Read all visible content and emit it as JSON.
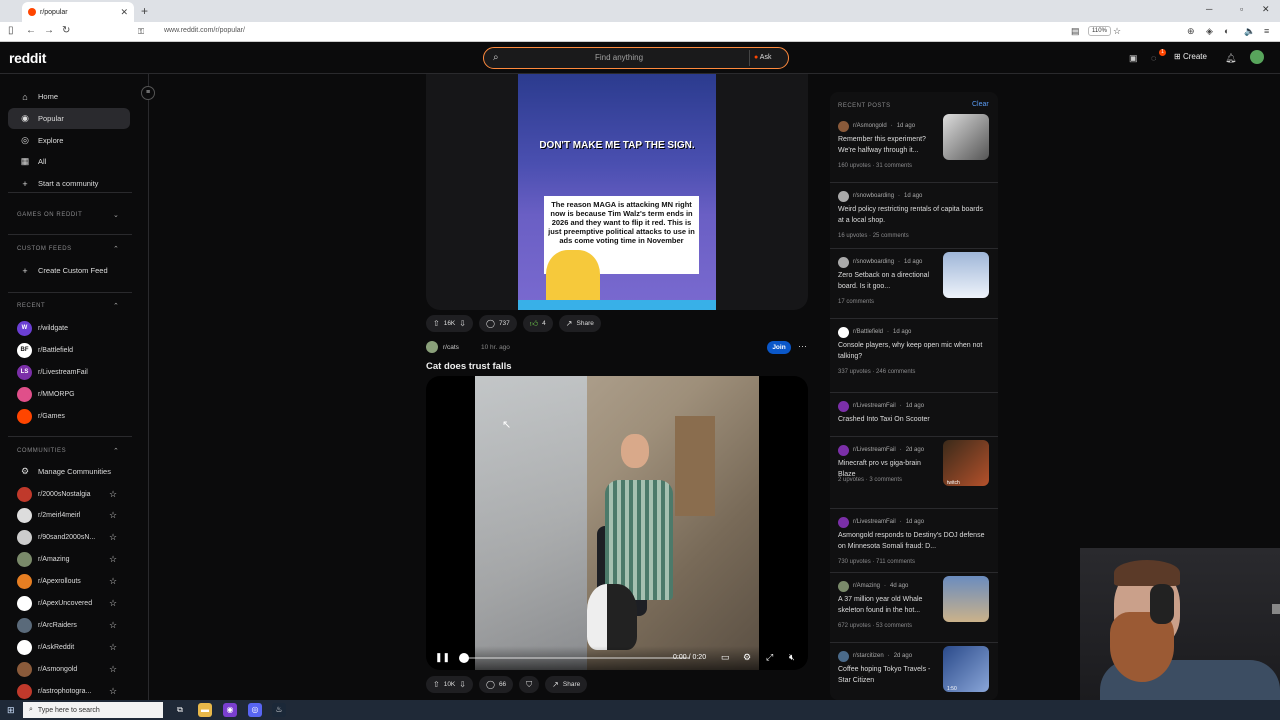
{
  "browser": {
    "tab_title": "r/popular",
    "url": "www.reddit.com/r/popular/",
    "zoom": "110%"
  },
  "header": {
    "logo": "reddit",
    "search_placeholder": "Find anything",
    "ask_label": "Ask",
    "create_label": "Create",
    "chat_badge": "1"
  },
  "sidebar": {
    "nav": [
      {
        "label": "Home",
        "icon": "home-icon"
      },
      {
        "label": "Popular",
        "icon": "popular-icon"
      },
      {
        "label": "Explore",
        "icon": "explore-icon"
      },
      {
        "label": "All",
        "icon": "all-icon"
      },
      {
        "label": "Start a community",
        "icon": "plus-icon"
      }
    ],
    "games_header": "GAMES ON REDDIT",
    "custom_feeds_header": "CUSTOM FEEDS",
    "create_custom_feed": "Create Custom Feed",
    "recent_header": "RECENT",
    "recent": [
      {
        "name": "r/wildgate",
        "color": "#6b3fd4",
        "abbr": "W"
      },
      {
        "name": "r/Battlefield",
        "color": "#ffffff",
        "abbr": "BF"
      },
      {
        "name": "r/LivestreamFail",
        "color": "#7b2fa8",
        "abbr": "LS"
      },
      {
        "name": "r/MMORPG",
        "color": "#e04f8a",
        "abbr": ""
      },
      {
        "name": "r/Games",
        "color": "#ff4500",
        "abbr": ""
      }
    ],
    "communities_header": "COMMUNITIES",
    "manage_communities": "Manage Communities",
    "communities": [
      {
        "name": "r/2000sNostalgia",
        "color": "#c0392b"
      },
      {
        "name": "r/2meirl4meirl",
        "color": "#dddddd"
      },
      {
        "name": "r/90sand2000sN...",
        "color": "#cccccc"
      },
      {
        "name": "r/Amazing",
        "color": "#7a8a6a"
      },
      {
        "name": "r/Apexrollouts",
        "color": "#e67e22"
      },
      {
        "name": "r/ApexUncovered",
        "color": "#ffffff"
      },
      {
        "name": "r/ArcRaiders",
        "color": "#5a6a7a"
      },
      {
        "name": "r/AskReddit",
        "color": "#ffffff"
      },
      {
        "name": "r/Asmongold",
        "color": "#8a5a3a"
      },
      {
        "name": "r/astrophotogra...",
        "color": "#c0392b"
      }
    ]
  },
  "post1": {
    "meme_caption": "DON'T MAKE ME TAP THE SIGN.",
    "sign_text": "The reason MAGA is attacking MN right now is because Tim Walz's term ends in 2026 and they want to flip it red. This is just preemptive political attacks to use in ads come voting time in November",
    "upvotes": "16K",
    "comments": "737",
    "awards": "4",
    "share": "Share"
  },
  "post2": {
    "subreddit": "r/cats",
    "time": "10 hr. ago",
    "join": "Join",
    "title": "Cat does trust falls",
    "video_time": "0:00 / 0:20",
    "upvotes": "10K",
    "comments": "66",
    "share": "Share"
  },
  "recent_posts": {
    "header": "RECENT POSTS",
    "clear": "Clear",
    "items": [
      {
        "sub": "r/Asmongold",
        "time": "1d ago",
        "title": "Remember this experiment? We're halfway through it...",
        "upvotes": "160 upvotes",
        "comments": "31 comments",
        "thumb": true,
        "color": "#8a5a3a"
      },
      {
        "sub": "r/snowboarding",
        "time": "1d ago",
        "title": "Weird policy restricting rentals of capita boards at a local shop.",
        "upvotes": "16 upvotes",
        "comments": "25 comments",
        "thumb": false,
        "color": "#aaaaaa"
      },
      {
        "sub": "r/snowboarding",
        "time": "1d ago",
        "title": "Zero Setback on a directional board. Is it goo...",
        "upvotes": "",
        "comments": "17 comments",
        "thumb": true,
        "color": "#aaaaaa"
      },
      {
        "sub": "r/Battlefield",
        "time": "1d ago",
        "title": "Console players, why keep open mic when not talking?",
        "upvotes": "337 upvotes",
        "comments": "246 comments",
        "thumb": false,
        "color": "#ffffff"
      },
      {
        "sub": "r/LivestreamFail",
        "time": "1d ago",
        "title": "Crashed Into Taxi On Scooter",
        "upvotes": "",
        "comments": "",
        "thumb": false,
        "color": "#7b2fa8"
      },
      {
        "sub": "r/LivestreamFail",
        "time": "2d ago",
        "title": "Minecraft pro vs giga-brain Blaze",
        "upvotes": "2 upvotes",
        "comments": "3 comments",
        "thumb": true,
        "color": "#7b2fa8",
        "tag": "twitch"
      },
      {
        "sub": "r/LivestreamFail",
        "time": "1d ago",
        "title": "Asmongold responds to Destiny's DOJ defense on Minnesota Somali fraud: D...",
        "upvotes": "730 upvotes",
        "comments": "711 comments",
        "thumb": false,
        "color": "#7b2fa8"
      },
      {
        "sub": "r/Amazing",
        "time": "4d ago",
        "title": "A 37 million year old Whale skeleton found in the hot...",
        "upvotes": "672 upvotes",
        "comments": "53 comments",
        "thumb": true,
        "color": "#7a8a6a"
      },
      {
        "sub": "r/starcitizen",
        "time": "2d ago",
        "title": "Coffee hoping Tokyo Travels - Star Citizen",
        "upvotes": "",
        "comments": "",
        "thumb": true,
        "color": "#4a6a8a",
        "tag": "1:50"
      }
    ]
  },
  "taskbar": {
    "search_placeholder": "Type here to search"
  }
}
